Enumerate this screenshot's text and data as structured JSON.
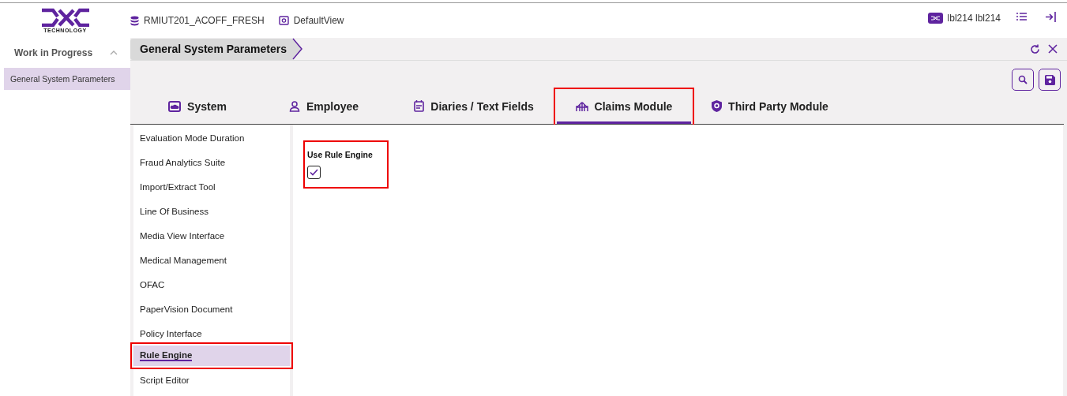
{
  "header": {
    "logo_text": "TECHNOLOGY",
    "database": "RMIUT201_ACOFF_FRESH",
    "view": "DefaultView",
    "user": "lbl214 lbl214"
  },
  "sidebar": {
    "title": "Work in Progress",
    "expanded": true,
    "items": [
      {
        "label": "General System Parameters",
        "selected": true
      }
    ]
  },
  "page": {
    "breadcrumb": "General System Parameters"
  },
  "tabs": [
    {
      "label": "System",
      "selected": false,
      "highlighted": false
    },
    {
      "label": "Employee",
      "selected": false,
      "highlighted": false
    },
    {
      "label": "Diaries / Text Fields",
      "selected": false,
      "highlighted": false
    },
    {
      "label": "Claims Module",
      "selected": true,
      "highlighted": true
    },
    {
      "label": "Third Party Module",
      "selected": false,
      "highlighted": false
    }
  ],
  "nav": [
    {
      "label": "Evaluation Mode Duration",
      "selected": false
    },
    {
      "label": "Fraud Analytics Suite",
      "selected": false
    },
    {
      "label": "Import/Extract Tool",
      "selected": false
    },
    {
      "label": "Line Of Business",
      "selected": false
    },
    {
      "label": "Media View Interface",
      "selected": false
    },
    {
      "label": "Medical Management",
      "selected": false
    },
    {
      "label": "OFAC",
      "selected": false
    },
    {
      "label": "PaperVision Document",
      "selected": false
    },
    {
      "label": "Policy Interface",
      "selected": false
    },
    {
      "label": "Rule Engine",
      "selected": true,
      "highlighted": true
    },
    {
      "label": "Script Editor",
      "selected": false
    }
  ],
  "fields": [
    {
      "label": "Use Rule Engine",
      "checked": true,
      "highlighted": true
    }
  ]
}
